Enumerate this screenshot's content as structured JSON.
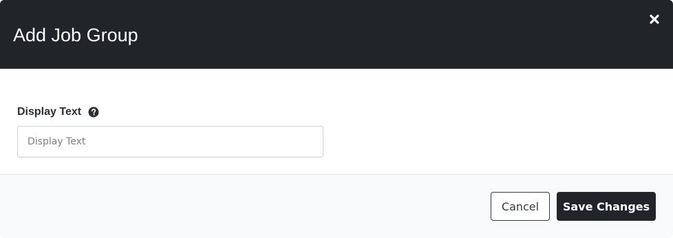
{
  "modal": {
    "title": "Add Job Group",
    "close_icon": "close-icon"
  },
  "form": {
    "display_text": {
      "label": "Display Text",
      "help_icon": "question-circle-icon",
      "value": "",
      "placeholder": "Display Text"
    }
  },
  "footer": {
    "cancel_label": "Cancel",
    "save_label": "Save Changes"
  },
  "colors": {
    "header_bg": "#212529",
    "primary_button": "#212529",
    "footer_bg": "#f8f9fa"
  }
}
